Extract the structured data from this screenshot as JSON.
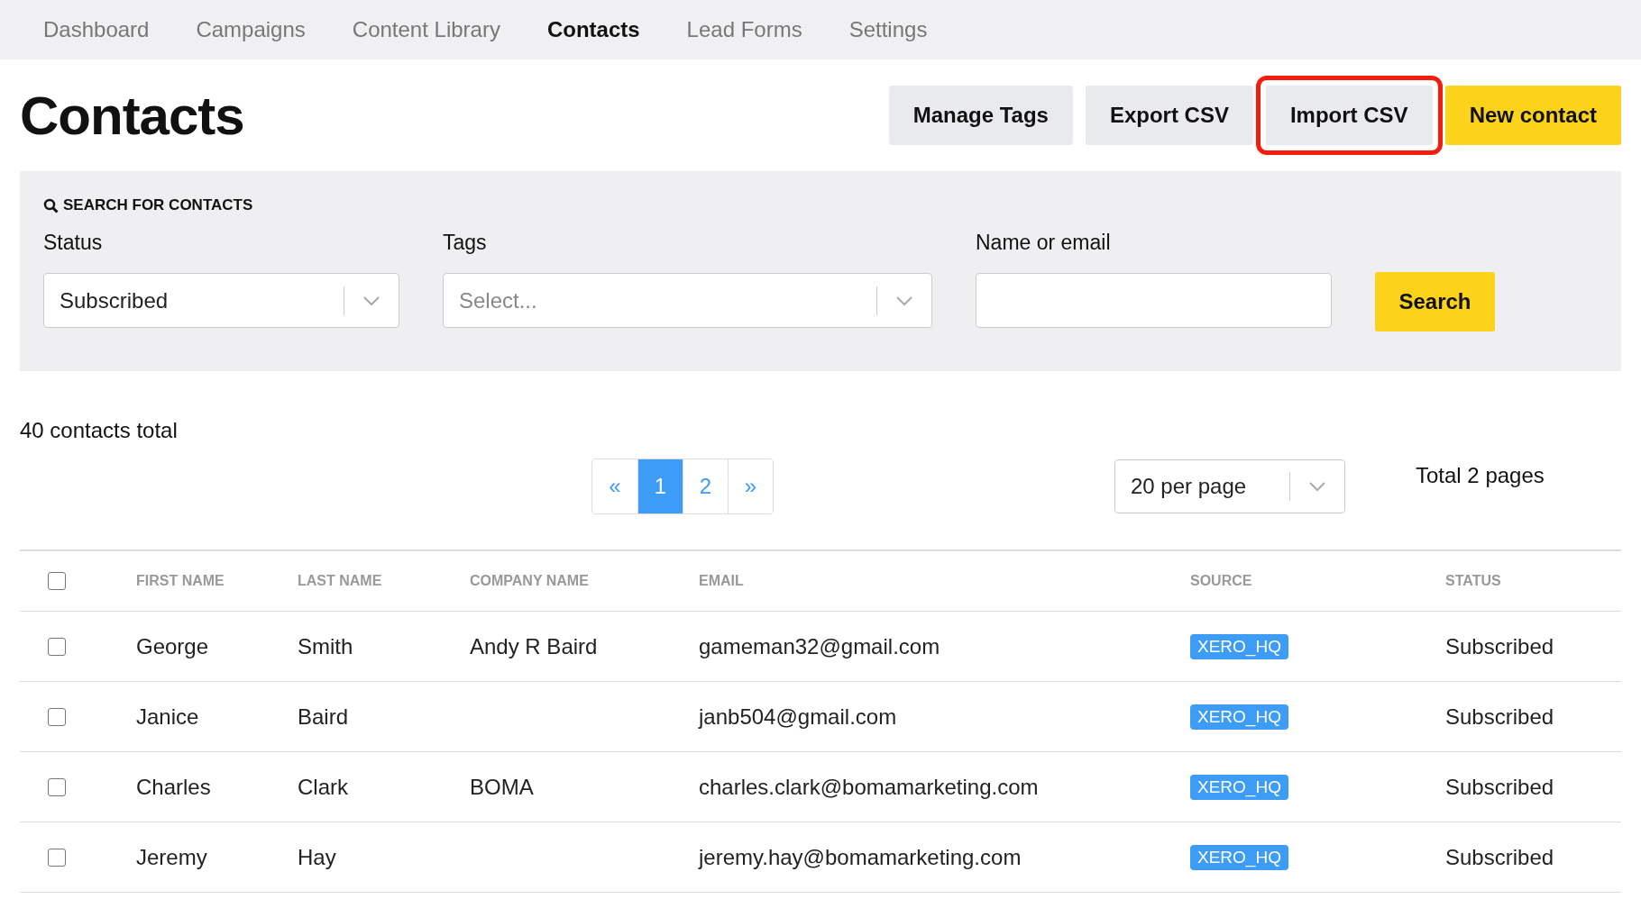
{
  "nav": [
    {
      "label": "Dashboard",
      "selected": false
    },
    {
      "label": "Campaigns",
      "selected": false
    },
    {
      "label": "Content Library",
      "selected": false
    },
    {
      "label": "Contacts",
      "selected": true
    },
    {
      "label": "Lead Forms",
      "selected": false
    },
    {
      "label": "Settings",
      "selected": false
    }
  ],
  "title": "Contacts",
  "actions": [
    {
      "label": "Manage Tags",
      "kind": "secondary",
      "highlighted": false
    },
    {
      "label": "Export CSV",
      "kind": "secondary",
      "highlighted": false
    },
    {
      "label": "Import CSV",
      "kind": "secondary",
      "highlighted": true
    },
    {
      "label": "New contact",
      "kind": "primary",
      "highlighted": false
    }
  ],
  "search": {
    "heading": "SEARCH FOR CONTACTS",
    "status": {
      "label": "Status",
      "value": "Subscribed"
    },
    "tags": {
      "label": "Tags",
      "placeholder": "Select..."
    },
    "name": {
      "label": "Name or email"
    },
    "button": "Search"
  },
  "total": "40 contacts total",
  "pagination": {
    "prev": "«",
    "next": "»",
    "pages": [
      {
        "label": "1",
        "selected": true
      },
      {
        "label": "2",
        "selected": false
      }
    ]
  },
  "per_page": "20 per page",
  "total_pages": "Total 2 pages",
  "table": {
    "all_checked": false,
    "columns": [
      "FIRST NAME",
      "LAST NAME",
      "COMPANY NAME",
      "EMAIL",
      "SOURCE",
      "STATUS"
    ],
    "rows": [
      {
        "checked": false,
        "first": "George",
        "last": "Smith",
        "company": "Andy R Baird",
        "email": "gameman32@gmail.com",
        "source": "XERO_HQ",
        "status": "Subscribed"
      },
      {
        "checked": false,
        "first": "Janice",
        "last": "Baird",
        "email": "janb504@gmail.com",
        "source": "XERO_HQ",
        "status": "Subscribed"
      },
      {
        "checked": false,
        "first": "Charles",
        "last": "Clark",
        "company": "BOMA",
        "email": "charles.clark@bomamarketing.com",
        "source": "XERO_HQ",
        "status": "Subscribed"
      },
      {
        "checked": false,
        "first": "Jeremy",
        "last": "Hay",
        "email": "jeremy.hay@bomamarketing.com",
        "source": "XERO_HQ",
        "status": "Subscribed"
      }
    ]
  }
}
